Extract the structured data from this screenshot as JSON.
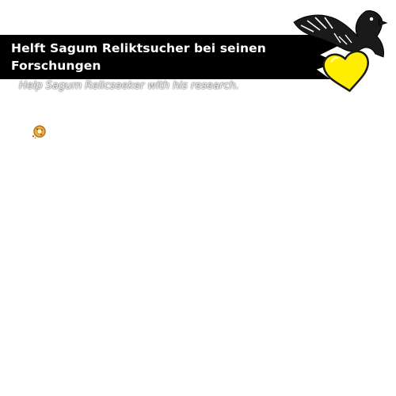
{
  "quest": {
    "title": "Helft Sagum Reliktsucher bei seinen Forschungen",
    "subtitle": "Help Sagum Relicseeker with his research."
  },
  "icons": {
    "emblem": "eagle-heart-emblem",
    "reward": "cookie-icon"
  },
  "colors": {
    "banner": "#000000",
    "heart": "#ffee00",
    "title_text": "#ffffff"
  }
}
